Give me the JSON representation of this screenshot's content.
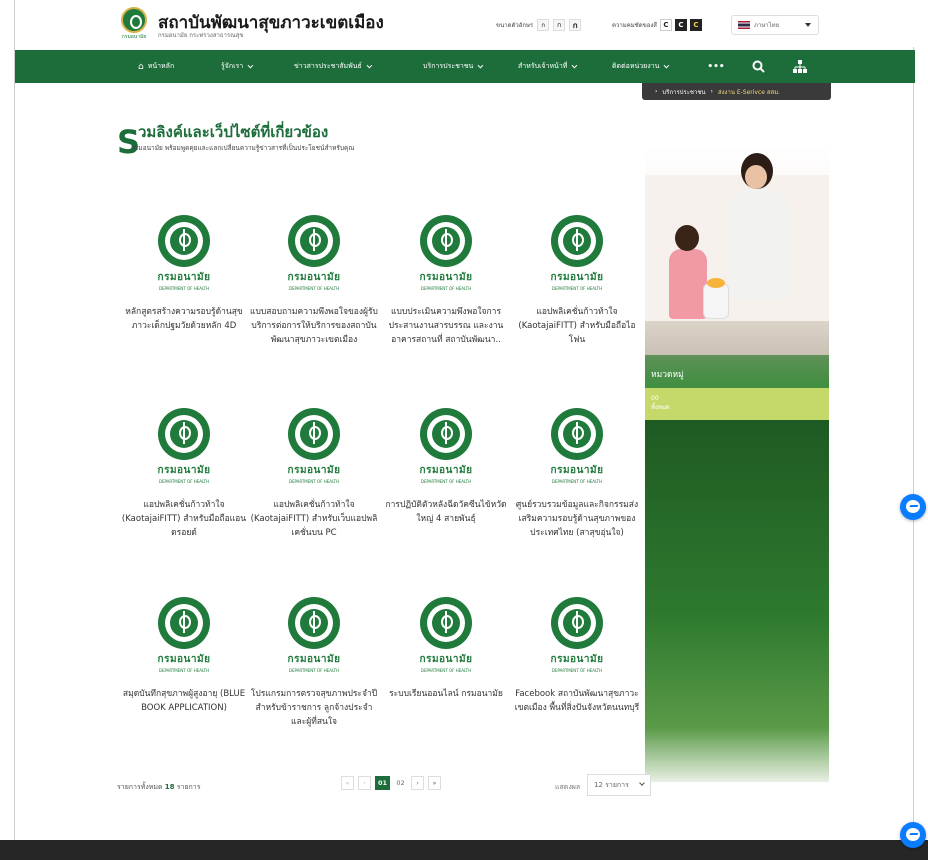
{
  "header": {
    "logo_caption": "กรมอนามัย",
    "title": "สถาบันพัฒนาสุขภาวะเขตเมือง",
    "subtitle": "กรมอนามัย กระทรวงสาธารณสุข",
    "font_size_label": "ขนาดตัวอักษร",
    "font_sizes": [
      "ก",
      "ก",
      "ก"
    ],
    "contrast_label": "ความคมชัดของสี",
    "contrast_options": [
      "C",
      "C",
      "C"
    ],
    "language": "ภาษาไทย"
  },
  "nav": {
    "items": [
      {
        "label": "หน้าหลัก",
        "icon": "home-icon"
      },
      {
        "label": "รู้จักเรา"
      },
      {
        "label": "ข่าวสารประชาสัมพันธ์"
      },
      {
        "label": "บริการประชาชน"
      },
      {
        "label": "สำหรับเจ้าหน้าที่"
      },
      {
        "label": "ติดต่อหน่วยงาน"
      }
    ],
    "more": "•••",
    "search_icon": "search-icon",
    "sitemap_icon": "sitemap-icon"
  },
  "breadcrumb": {
    "items": [
      "บริการประชาชน",
      "ส่งงาน E-Serivce สสม."
    ]
  },
  "page": {
    "title_initial": "S",
    "title": "วมลิงค์และเว็ปไซต์ที่เกี่ยวข้อง",
    "subtitle": "กรมอนามัย พร้อมพูดคุยและแลกเปลี่ยนความรู้ข่าวสารที่เป็นประโยชน์สำหรับคุณ"
  },
  "emblem": {
    "name_th": "กรมอนามัย",
    "name_en": "DEPARTMENT OF HEALTH"
  },
  "cards": [
    {
      "title": "หลักสูตรสร้างความรอบรู้ด้านสุขภาวะเด็กปฐมวัยด้วยหลัก 4D"
    },
    {
      "title": "แบบสอบถามความพึงพอใจของผู้รับบริการต่อการให้บริการของสถาบันพัฒนาสุขภาวะเขตเมือง"
    },
    {
      "title": "แบบประเมินความพึงพอใจการประสานงานสารบรรณ และงานอาคารสถานที่ สถาบันพัฒนา.."
    },
    {
      "title": "แอปพลิเคชั่นก้าวท้าใจ (KaotajaiFITT) สำหรับมือถือไอโฟน"
    },
    {
      "title": "แอปพลิเคชั่นก้าวท้าใจ (KaotajaiFITT) สำหรับมือถือแอนดรอยด์"
    },
    {
      "title": "แอปพลิเคชั่นก้าวท้าใจ (KaotajaiFITT) สำหรับเว็บแอปพลิเคชั่นบน PC"
    },
    {
      "title": "การปฏิบัติตัวหลังฉีดวัคซีนไข้หวัดใหญ่ 4 สายพันธุ์"
    },
    {
      "title": "ศูนย์รวบรวมข้อมูลและกิจกรรมส่งเสริมความรอบรู้ด้านสุขภาพของประเทศไทย (สาสุขอุ่นใจ)"
    },
    {
      "title": "สมุดบันทึกสุขภาพผู้สูงอายุ (BLUE BOOK APPLICATION)"
    },
    {
      "title": "โปรแกรมการตรวจสุขภาพประจำปี สำหรับข้าราชการ ลูกจ้างประจำ และผู้ที่สนใจ"
    },
    {
      "title": "ระบบเรียนออนไลน์ กรมอนามัย"
    },
    {
      "title": "Facebook สถาบันพัฒนาสุขภาวะเขตเมือง พื้นที่สิ่งปันจังหวัดนนทบุรี"
    }
  ],
  "sidebar": {
    "category_title": "หมวดหมู่",
    "all_count": "00",
    "all_label": "ทั้งหมด"
  },
  "footer": {
    "total_prefix": "รายการทั้งหมด",
    "total_count": "18",
    "total_suffix": "รายการ",
    "pages": [
      "«",
      "‹",
      "01",
      "02",
      "›",
      "»"
    ],
    "active_page": "01",
    "show_label": "แสดงผล",
    "show_value": "12 รายการ"
  },
  "colors": {
    "brand_green": "#1d6d3b",
    "lime": "#c4d96a",
    "messenger_blue": "#0a7cff"
  }
}
